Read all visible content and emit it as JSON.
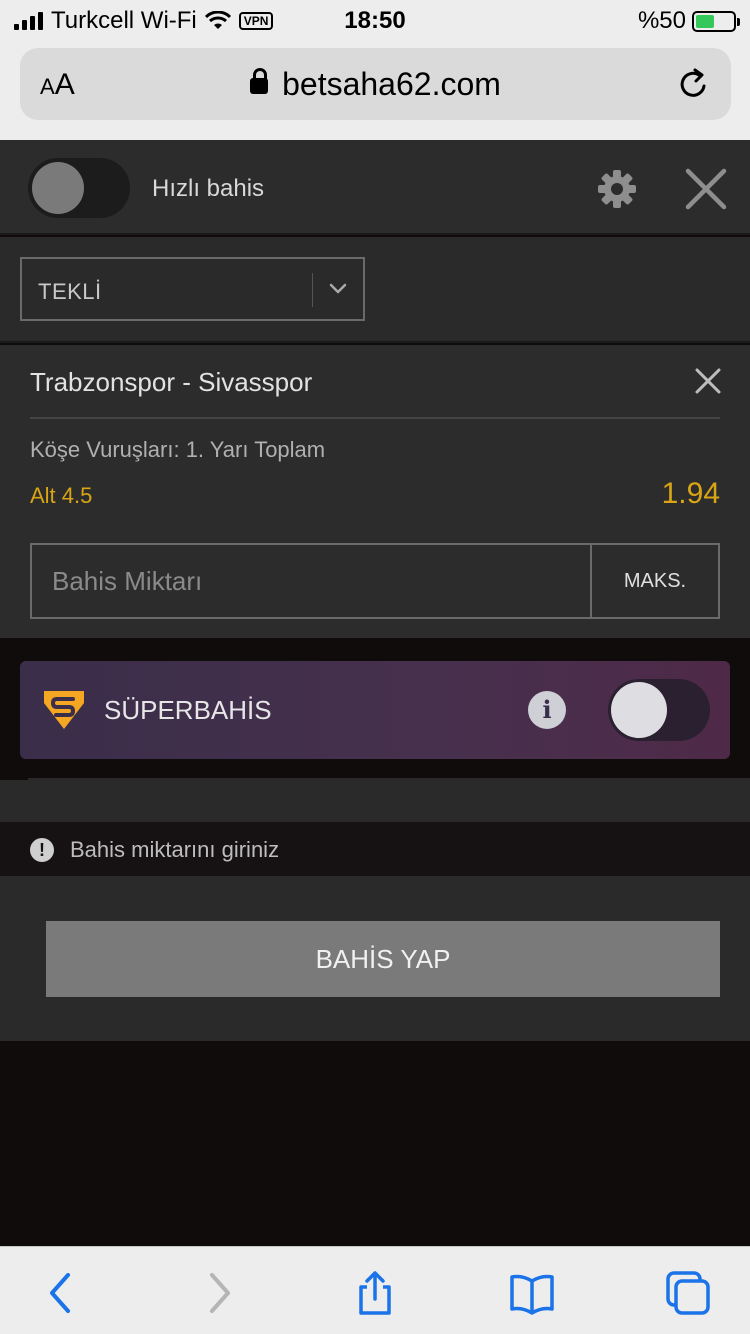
{
  "status_bar": {
    "carrier": "Turkcell Wi-Fi",
    "vpn": "VPN",
    "time": "18:50",
    "battery": "%50",
    "battery_level": 0.5
  },
  "browser": {
    "text_size_label": "AA",
    "url": "betsaha62.com",
    "icons": [
      "lock-icon",
      "reload-icon",
      "back-icon",
      "forward-icon",
      "share-icon",
      "bookmarks-icon",
      "tabs-icon"
    ]
  },
  "slip_header": {
    "quick_bet_label": "Hızlı bahis",
    "quick_bet_on": false
  },
  "bet_type": {
    "selected": "TEKLİ"
  },
  "selection": {
    "match": "Trabzonspor - Sivasspor",
    "market": "Köşe Vuruşları: 1. Yarı Toplam",
    "pick": "Alt 4.5",
    "odds": "1.94",
    "stake_placeholder": "Bahis Miktarı",
    "stake_value": "",
    "max_label": "MAKS."
  },
  "super_bet": {
    "label": "SÜPERBAHİS",
    "enabled": false
  },
  "warning": {
    "text": "Bahis miktarını giriniz"
  },
  "place_bet": {
    "label": "BAHİS YAP"
  },
  "colors": {
    "accent_gold": "#d9a515",
    "ios_blue": "#1a73e8",
    "panel": "#2c2c2c"
  }
}
